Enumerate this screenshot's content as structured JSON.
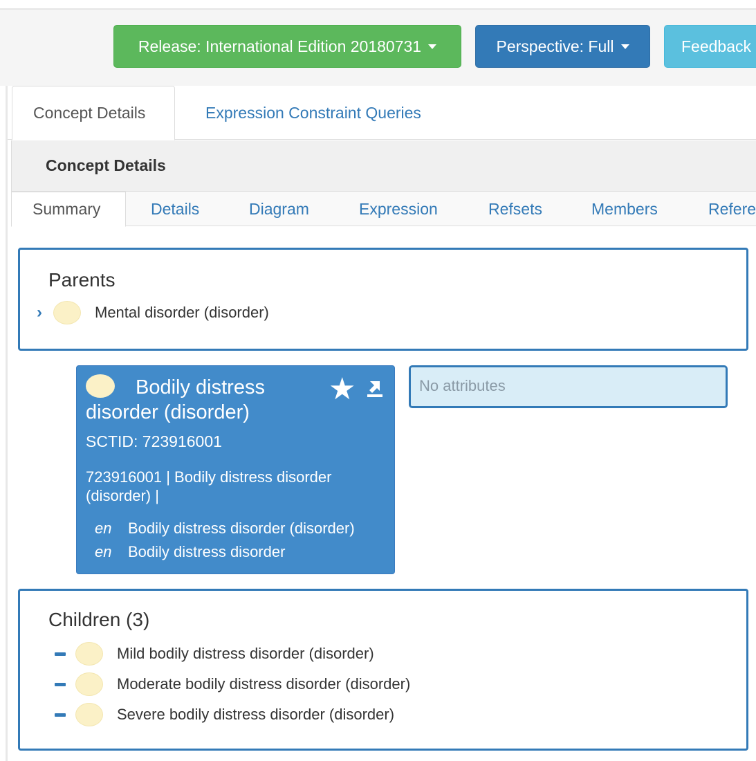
{
  "toolbar": {
    "release_label": "Release: International Edition 20180731",
    "perspective_label": "Perspective: Full",
    "feedback_label": "Feedback"
  },
  "outer_tabs": [
    {
      "label": "Concept Details",
      "active": true
    },
    {
      "label": "Expression Constraint Queries",
      "active": false
    }
  ],
  "panel": {
    "heading": "Concept Details"
  },
  "inner_tabs": [
    {
      "label": "Summary",
      "active": true
    },
    {
      "label": "Details"
    },
    {
      "label": "Diagram"
    },
    {
      "label": "Expression"
    },
    {
      "label": "Refsets"
    },
    {
      "label": "Members"
    },
    {
      "label": "Refere"
    }
  ],
  "parents": {
    "title": "Parents",
    "items": [
      {
        "label": "Mental disorder (disorder)"
      }
    ]
  },
  "concept": {
    "title": "Bodily distress disorder (disorder)",
    "sctid_label": "SCTID: 723916001",
    "fsn_line": "723916001 | Bodily distress disorder (disorder) |",
    "descriptions": [
      {
        "lang": "en",
        "term": "Bodily distress disorder (disorder)"
      },
      {
        "lang": "en",
        "term": "Bodily distress disorder"
      }
    ]
  },
  "attributes": {
    "empty_text": "No attributes"
  },
  "children": {
    "title": "Children (3)",
    "items": [
      {
        "label": "Mild bodily distress disorder (disorder)"
      },
      {
        "label": "Moderate bodily distress disorder (disorder)"
      },
      {
        "label": "Severe bodily distress disorder (disorder)"
      }
    ]
  },
  "colors": {
    "release_button": "#5cb85c",
    "perspective_button": "#337ab7",
    "feedback_button": "#5bc0de",
    "concept_card": "#428bca",
    "concept_bubble": "#fbf1c7",
    "attributes_box": "#d9edf7"
  }
}
